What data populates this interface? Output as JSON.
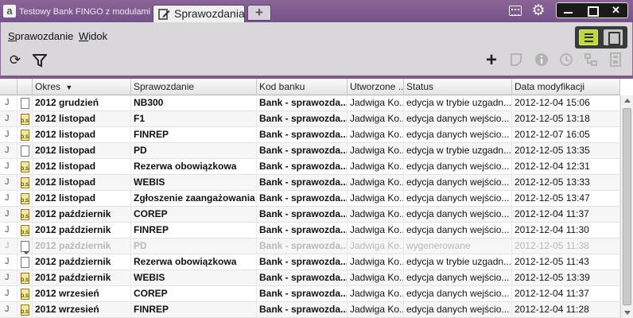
{
  "window": {
    "inactive_tab_title": "Testowy Bank FINGO z modulami",
    "active_tab_title": "Sprawozdania",
    "add_tab_label": "+",
    "accent_color": "#7d5a88",
    "icons": [
      "app-logo-icon",
      "document-edit-icon",
      "tray-icon",
      "gear-icon",
      "minimize-icon",
      "maximize-icon",
      "close-icon"
    ]
  },
  "menu": {
    "report_pre": "",
    "report_ul": "S",
    "report_post": "prawozdanie",
    "view_pre": "",
    "view_ul": "W",
    "view_post": "idok"
  },
  "toolbar": {
    "icons_left": [
      "refresh-icon",
      "filter-icon"
    ],
    "icons_right": [
      "add-icon",
      "edit-icon",
      "info-icon",
      "history-icon",
      "tree-icon",
      "calculator-icon"
    ],
    "view_modes": [
      "list-view-icon",
      "card-view-icon"
    ],
    "active_view_color": "#bcd74a"
  },
  "grid": {
    "columns": [
      "",
      "",
      "Okres",
      "Sprawozdanie",
      "Kod banku",
      "Utworzone ...",
      "Status",
      "Data modyfikacji"
    ],
    "sort_indicator": "▼",
    "rows": [
      {
        "flag": "J",
        "icon": "doc",
        "okres": "2012 grudzień",
        "sprawozdanie": "NB300",
        "kod": "Bank - sprawozda...",
        "utw": "Jadwiga Ko...",
        "status": "edycja w trybie uzgadn...",
        "data": "2012-12-04 15:06"
      },
      {
        "flag": "J",
        "icon": "ds",
        "okres": "2012 listopad",
        "sprawozdanie": "F1",
        "kod": "Bank - sprawozda...",
        "utw": "Jadwiga Ko...",
        "status": "edycja danych wejścio...",
        "data": "2012-12-05 13:18"
      },
      {
        "flag": "J",
        "icon": "ds",
        "okres": "2012 listopad",
        "sprawozdanie": "FINREP",
        "kod": "Bank - sprawozda...",
        "utw": "Jadwiga Ko...",
        "status": "edycja danych wejścio...",
        "data": "2012-12-07 16:05"
      },
      {
        "flag": "J",
        "icon": "doc",
        "okres": "2012 listopad",
        "sprawozdanie": "PD",
        "kod": "Bank - sprawozda...",
        "utw": "Jadwiga Ko...",
        "status": "edycja w trybie uzgadn...",
        "data": "2012-12-05 13:35"
      },
      {
        "flag": "J",
        "icon": "ds",
        "okres": "2012 listopad",
        "sprawozdanie": "Rezerwa obowiązkowa",
        "kod": "Bank - sprawozda...",
        "utw": "Jadwiga Ko...",
        "status": "edycja danych wejścio...",
        "data": "2012-12-04 12:31"
      },
      {
        "flag": "J",
        "icon": "ds",
        "okres": "2012 listopad",
        "sprawozdanie": "WEBIS",
        "kod": "Bank - sprawozda...",
        "utw": "Jadwiga Ko...",
        "status": "edycja danych wejścio...",
        "data": "2012-12-05 13:33"
      },
      {
        "flag": "J",
        "icon": "ds",
        "okres": "2012 listopad",
        "sprawozdanie": "Zgłoszenie zaangażowania",
        "kod": "Bank - sprawozda...",
        "utw": "Jadwiga Ko...",
        "status": "edycja danych wejścio...",
        "data": "2012-12-05 13:47"
      },
      {
        "flag": "J",
        "icon": "ds",
        "okres": "2012 październik",
        "sprawozdanie": "COREP",
        "kod": "Bank - sprawozda...",
        "utw": "Jadwiga Ko...",
        "status": "edycja danych wejścio...",
        "data": "2012-12-04 11:37"
      },
      {
        "flag": "J",
        "icon": "ds",
        "okres": "2012 październik",
        "sprawozdanie": "FINREP",
        "kod": "Bank - sprawozda...",
        "utw": "Jadwiga Ko...",
        "status": "edycja danych wejścio...",
        "data": "2012-12-04 11:30"
      },
      {
        "flag": "J",
        "icon": "gen",
        "okres": "2012 październik",
        "sprawozdanie": "PD",
        "kod": "Bank - sprawozda...",
        "utw": "Jadwiga Ko...",
        "status": "wygenerowane",
        "data": "2012-12-05 11:38",
        "dim": true
      },
      {
        "flag": "J",
        "icon": "doc",
        "okres": "2012 październik",
        "sprawozdanie": "Rezerwa obowiązkowa",
        "kod": "Bank - sprawozda...",
        "utw": "Jadwiga Ko...",
        "status": "edycja w trybie uzgadn...",
        "data": "2012-12-05 11:43"
      },
      {
        "flag": "J",
        "icon": "ds",
        "okres": "2012 październik",
        "sprawozdanie": "WEBIS",
        "kod": "Bank - sprawozda...",
        "utw": "Jadwiga Ko...",
        "status": "edycja danych wejścio...",
        "data": "2012-12-05 13:39"
      },
      {
        "flag": "J",
        "icon": "ds",
        "okres": "2012 wrzesień",
        "sprawozdanie": "COREP",
        "kod": "Bank - sprawozda...",
        "utw": "Jadwiga Ko...",
        "status": "edycja danych wejścio...",
        "data": "2012-12-04 11:37"
      },
      {
        "flag": "J",
        "icon": "ds",
        "okres": "2012 wrzesień",
        "sprawozdanie": "FINREP",
        "kod": "Bank - sprawozda...",
        "utw": "Jadwiga Ko...",
        "status": "edycja danych wejścio...",
        "data": "2012-12-04 11:28"
      }
    ]
  }
}
